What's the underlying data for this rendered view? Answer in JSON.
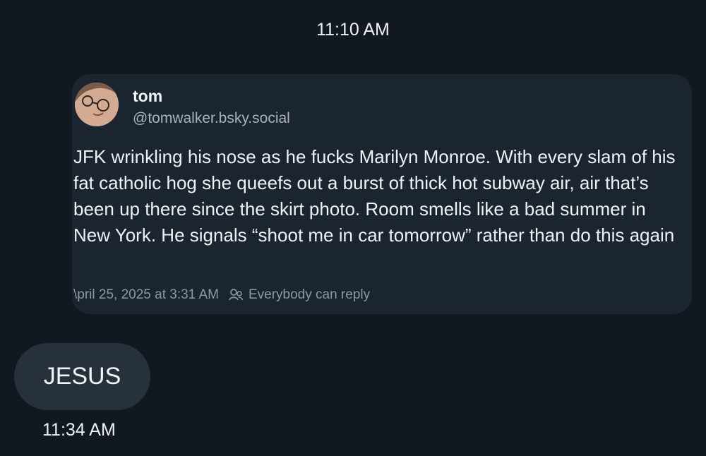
{
  "conversation": {
    "top_timestamp": "11:10 AM",
    "bottom_timestamp": "11:34 AM"
  },
  "embed": {
    "author_name": "tom",
    "author_handle": "@tomwalker.bsky.social",
    "post_text": "JFK wrinkling his nose as he fucks Marilyn Monroe. With every slam of his fat catholic hog she queefs out a burst of thick hot subway air, air that’s been up there since the skirt photo. Room smells like a bad summer in New York. He signals “shoot me in car tomorrow” rather than do this again",
    "post_date": "\\pril 25, 2025 at 3:31 AM",
    "reply_setting": "Everybody can reply",
    "reply_icon": "people-icon"
  },
  "message": {
    "text": "JESUS"
  },
  "colors": {
    "background": "#121820",
    "card": "#1b252f",
    "bubble": "#27313c",
    "secondary_text": "#a9b3bd"
  }
}
